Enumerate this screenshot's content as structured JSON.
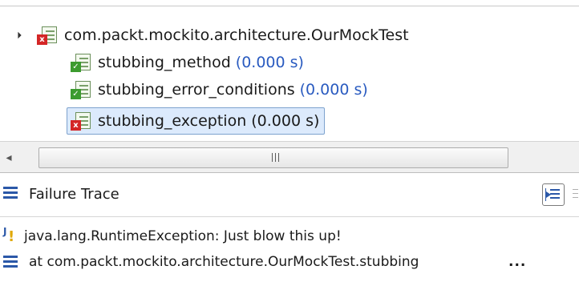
{
  "test_tree": {
    "suite": {
      "label": "com.packt.mockito.architecture.OurMockTest",
      "icon": "junit-suite-error-icon",
      "expanded": true
    },
    "tests": [
      {
        "name": "stubbing_method",
        "time": "(0.000 s)",
        "status": "passed",
        "icon": "junit-test-passed-icon",
        "selected": false
      },
      {
        "name": "stubbing_error_conditions",
        "time": "(0.000 s)",
        "status": "passed",
        "icon": "junit-test-passed-icon",
        "selected": false
      },
      {
        "name": "stubbing_exception",
        "time": "(0.000 s)",
        "status": "error",
        "icon": "junit-test-error-icon",
        "selected": true
      }
    ]
  },
  "scrollbar": {
    "left_arrow": "◂",
    "thumb_fraction": 0.81
  },
  "failure_trace": {
    "title": "Failure Trace",
    "filter_button_icon": "filter-stack-trace-icon",
    "lines": [
      {
        "icon": "junit-failure-icon",
        "text": "java.lang.RuntimeException: Just blow this up!"
      },
      {
        "icon": "stack-frame-icon",
        "text": "at com.packt.mockito.architecture.OurMockTest.stubbing",
        "ellipsis": "..."
      }
    ]
  },
  "colors": {
    "time_blue": "#2a5bc0",
    "selection_bg": "#dceafc",
    "selection_border": "#7da2ce",
    "pass_green": "#3c9b2f",
    "error_red": "#d42626",
    "icon_blue": "#2b58a8"
  }
}
